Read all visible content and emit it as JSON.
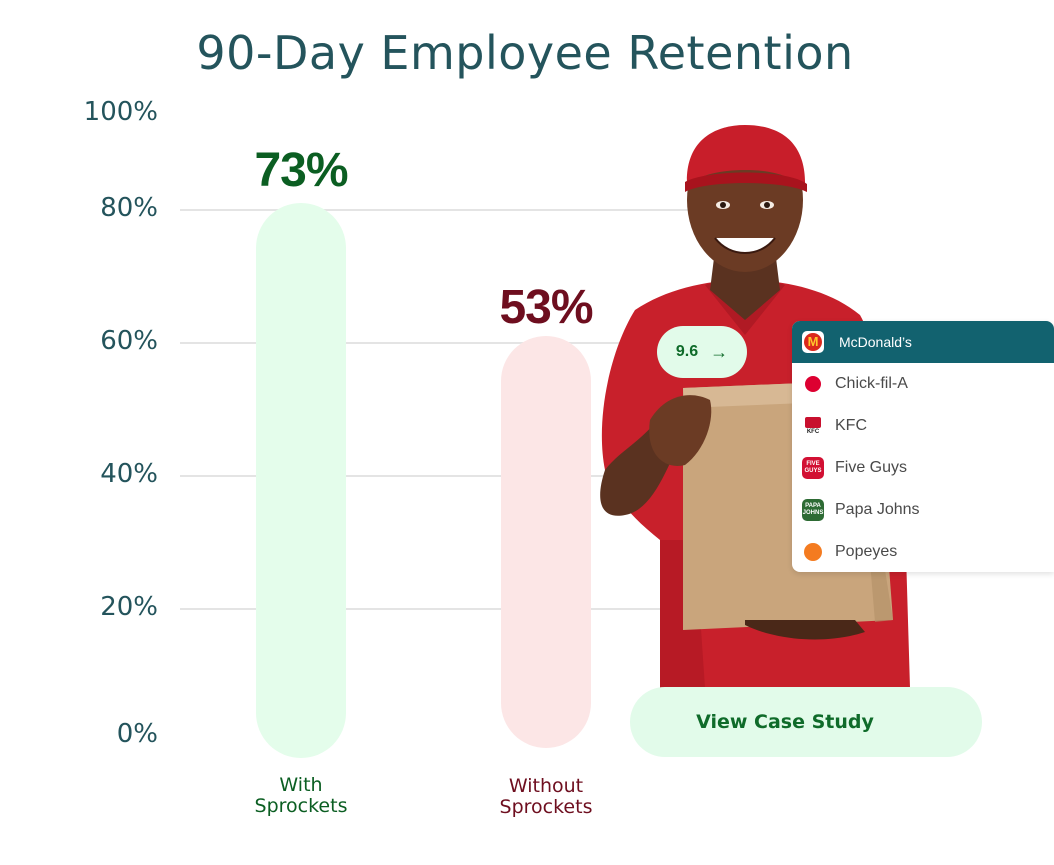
{
  "chart_data": {
    "type": "bar",
    "title": "90-Day Employee Retention",
    "categories": [
      "With\nSprockets",
      "Without\nSprockets"
    ],
    "values": [
      73,
      53
    ],
    "value_labels": [
      "73%",
      "53%"
    ],
    "colors": {
      "bar_fill": [
        "#e4fdeb",
        "#fce6e6"
      ],
      "label_text": [
        "#0b5e22",
        "#6e0e1f"
      ]
    },
    "xlabel": "",
    "ylabel": "",
    "ylim": [
      0,
      100
    ],
    "yticks": [
      "100%",
      "80%",
      "60%",
      "40%",
      "20%",
      "0%"
    ],
    "grid": true,
    "legend": "none"
  },
  "overlay": {
    "score_pill": {
      "value": "9.6",
      "arrow_icon": "→"
    },
    "dropdown": {
      "selected": "McDonald’s",
      "items": [
        {
          "label": "McDonald’s",
          "logo": "mcdonalds-logo",
          "logo_text": "M",
          "logo_color": "#da291c"
        },
        {
          "label": "Chick-fil-A",
          "logo": "chick-fil-a-logo",
          "logo_text": "",
          "logo_color": "#dd0031"
        },
        {
          "label": "KFC",
          "logo": "kfc-logo",
          "logo_text": "KFC",
          "logo_color": "#c8102e"
        },
        {
          "label": "Five Guys",
          "logo": "five-guys-logo",
          "logo_text": "FIVE GUYS",
          "logo_color": "#d21033"
        },
        {
          "label": "Papa Johns",
          "logo": "papa-johns-logo",
          "logo_text": "PAPA JOHNS",
          "logo_color": "#2d6b34"
        },
        {
          "label": "Popeyes",
          "logo": "popeyes-logo",
          "logo_text": "",
          "logo_color": "#f47b20"
        }
      ]
    },
    "cta_label": "View Case Study"
  },
  "colors": {
    "title": "#24545c",
    "accent_green": "#0f6b2a",
    "pill_bg": "#e2fbea",
    "dropdown_selected_bg": "#12626f"
  }
}
